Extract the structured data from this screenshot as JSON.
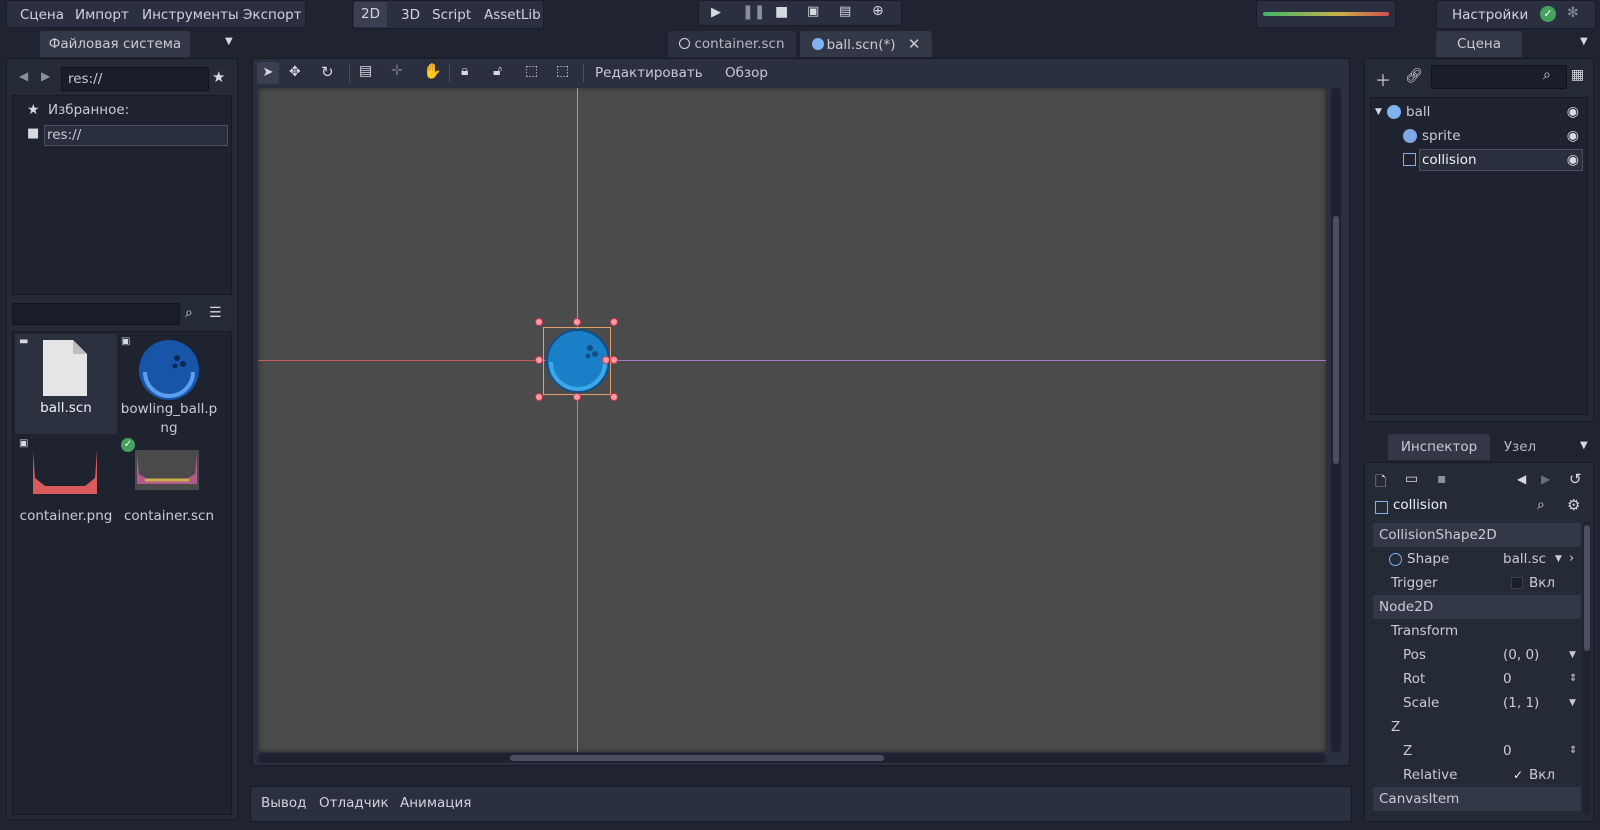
{
  "menu": {
    "scene": "Сцена",
    "import": "Импорт",
    "tools": "Инструменты",
    "export": "Экспорт",
    "settings": "Настройки"
  },
  "modes": {
    "2d": "2D",
    "3d": "3D",
    "script": "Script",
    "assetlib": "AssetLib"
  },
  "filesystem": {
    "tab": "Файловая система",
    "path": "res://",
    "favorites_label": "Избранное:",
    "tree_root": "res://",
    "files": [
      {
        "name": "ball.scn",
        "type": "scene"
      },
      {
        "name": "bowling_ball.png",
        "type": "image"
      },
      {
        "name": "container.png",
        "type": "image"
      },
      {
        "name": "container.scn",
        "type": "scene"
      }
    ]
  },
  "editor_tabs": [
    {
      "label": "container.scn"
    },
    {
      "label": "ball.scn(*)"
    }
  ],
  "toolbar": {
    "edit": "Редактировать",
    "view": "Обзор"
  },
  "scene_panel": {
    "tab": "Сцена",
    "nodes": [
      {
        "name": "ball",
        "icon": "globe-icon"
      },
      {
        "name": "sprite",
        "icon": "sprite-icon"
      },
      {
        "name": "collision",
        "icon": "collision-icon"
      }
    ]
  },
  "inspector": {
    "tab_inspector": "Инспектор",
    "tab_node": "Узел",
    "node_name": "collision",
    "sections": {
      "collision_shape": "CollisionShape2D",
      "node2d": "Node2D",
      "canvas_item": "CanvasItem"
    },
    "props": {
      "shape_label": "Shape",
      "shape_value": "ball.sc",
      "trigger_label": "Trigger",
      "trigger_value": "Вкл",
      "transform_label": "Transform",
      "pos_label": "Pos",
      "pos_value": "(0, 0)",
      "rot_label": "Rot",
      "rot_value": "0",
      "scale_label": "Scale",
      "scale_value": "(1, 1)",
      "z_group": "Z",
      "z_label": "Z",
      "z_value": "0",
      "relative_label": "Relative",
      "relative_value": "Вкл"
    }
  },
  "bottom": {
    "output": "Вывод",
    "debugger": "Отладчик",
    "animation": "Анимация"
  },
  "colors": {
    "accent": "#e0a170",
    "selection": "#d03a4a",
    "ball": "#1c6fbd"
  }
}
